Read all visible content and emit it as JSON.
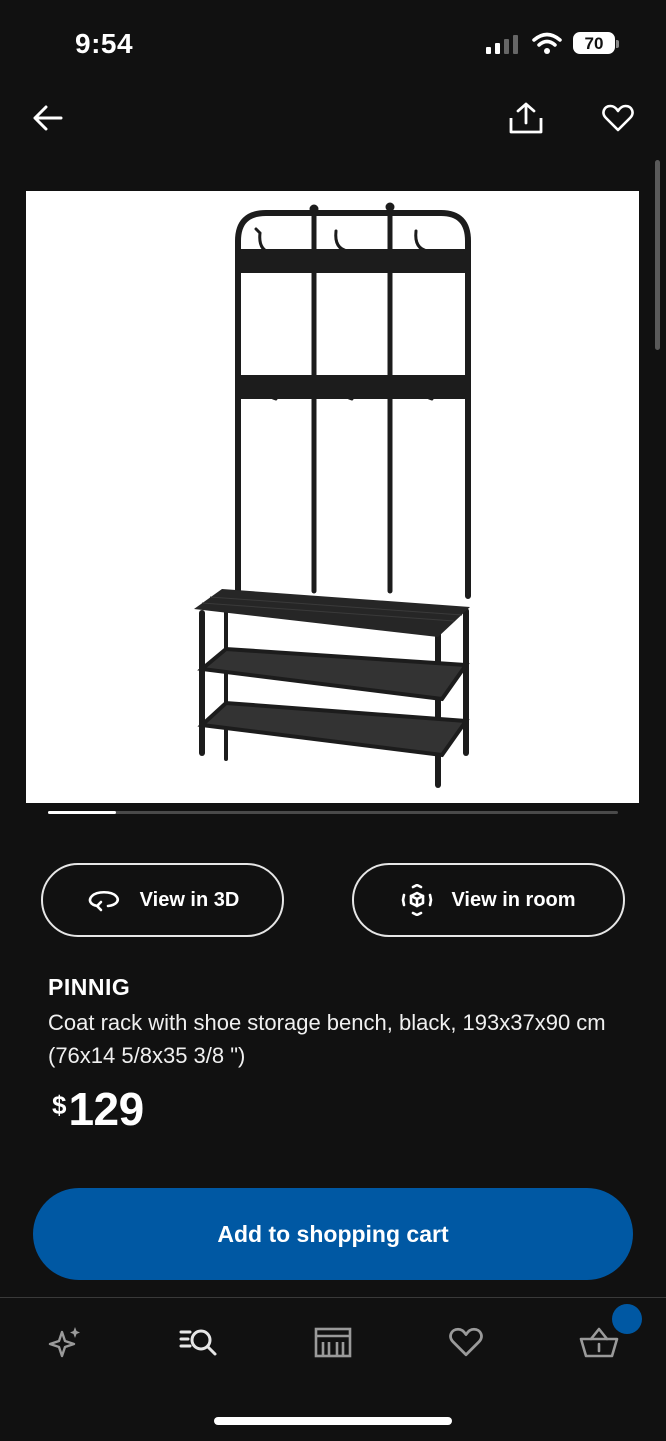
{
  "status_bar": {
    "time": "9:54",
    "battery": "70"
  },
  "nav": {
    "back_icon": "arrow-left-icon",
    "share_icon": "share-icon",
    "favorite_icon": "heart-icon"
  },
  "gallery": {
    "image_subject": "coat-rack-product-photo",
    "position_fraction": 0.12
  },
  "actions": {
    "view_3d_label": "View in 3D",
    "view_room_label": "View in room"
  },
  "product": {
    "name": "PINNIG",
    "description": "Coat rack with shoe storage bench, black, 193x37x90 cm (76x14 5/8x35 3/8 \")",
    "currency": "$",
    "price": "129"
  },
  "cart_button": {
    "label": "Add to shopping cart"
  },
  "tabbar": {
    "items": [
      "sparkle-icon",
      "search-icon",
      "store-icon",
      "heart-icon",
      "basket-icon"
    ]
  },
  "colors": {
    "accent": "#0058a3",
    "background": "#111111"
  }
}
